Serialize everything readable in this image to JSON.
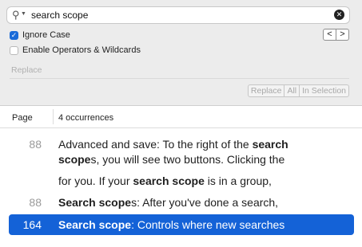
{
  "search": {
    "query": "search scope",
    "icon": "magnifier-with-dropdown",
    "clear_icon": "✕"
  },
  "options": {
    "ignore_case": {
      "label": "Ignore Case",
      "checked": true
    },
    "operators": {
      "label": "Enable Operators & Wildcards",
      "checked": false
    }
  },
  "nav": {
    "prev": "<",
    "next": ">"
  },
  "replace": {
    "placeholder": "Replace",
    "buttons": [
      "Replace",
      "All",
      "In Selection"
    ]
  },
  "table": {
    "col_page": "Page",
    "col_count": "4 occurrences",
    "rows": [
      {
        "page": "88",
        "pre": "Advanced and save: To the right of the ",
        "bold": "search",
        "post": ""
      },
      {
        "page": "",
        "pre": "",
        "bold": "scope",
        "post": "s, you will see two buttons. Clicking the"
      },
      {
        "page": "",
        "pre": "for you. If your ",
        "bold": "search scope",
        "post": " is in a group,"
      },
      {
        "page": "88",
        "pre": "",
        "bold": "Search scope",
        "post": "s: After you've done a search,"
      },
      {
        "page": "164",
        "pre": "",
        "bold": "Search scope",
        "post": ": Controls where new searches"
      }
    ],
    "selected_index": 4
  },
  "colors": {
    "accent": "#1462d7",
    "checkbox": "#1a6bd8"
  }
}
